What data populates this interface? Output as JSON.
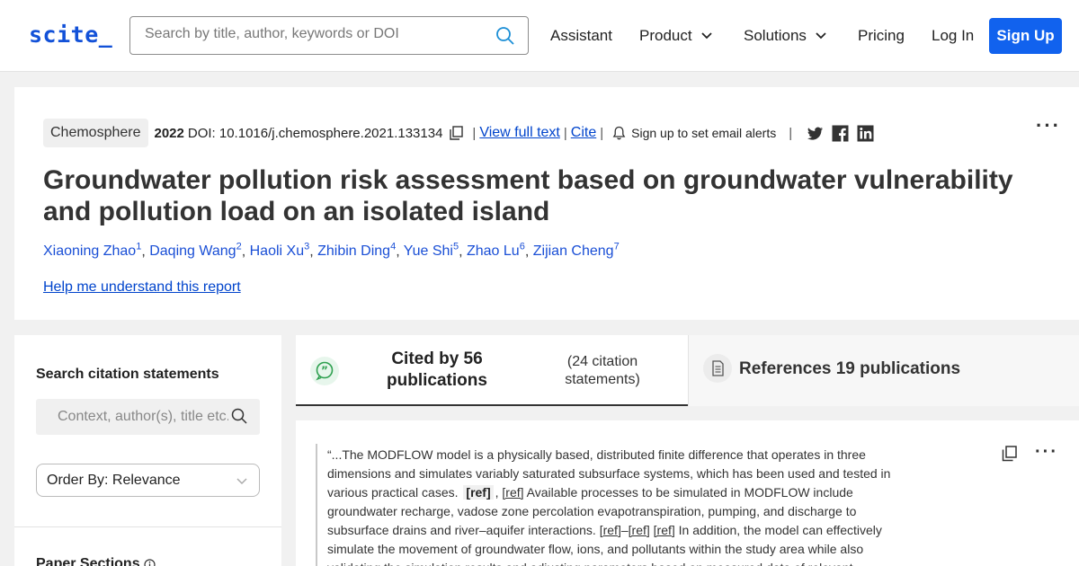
{
  "header": {
    "logo": "scite_",
    "search_placeholder": "Search by title, author, keywords or DOI",
    "nav": [
      {
        "label": "Assistant"
      },
      {
        "label": "Product"
      },
      {
        "label": "Solutions"
      },
      {
        "label": "Pricing"
      },
      {
        "label": "Log In"
      }
    ],
    "signup_label": "Sign Up"
  },
  "paper": {
    "journal": "Chemosphere",
    "year": "2022",
    "doi": "DOI: 10.1016/j.chemosphere.2021.133134",
    "sep": "|",
    "view_full_text": "View full text",
    "cite": "Cite",
    "alerts": "Sign up to set email alerts",
    "more": "···",
    "title": "Groundwater pollution risk assessment based on groundwater vulnerability and pollution load on an isolated island",
    "authors": [
      {
        "name": "Xiaoning Zhao",
        "sup": "1"
      },
      {
        "name": "Daqing Wang",
        "sup": "2"
      },
      {
        "name": "Haoli Xu",
        "sup": "3"
      },
      {
        "name": "Zhibin Ding",
        "sup": "4"
      },
      {
        "name": "Yue Shi",
        "sup": "5"
      },
      {
        "name": "Zhao Lu",
        "sup": "6"
      },
      {
        "name": "Zijian Cheng",
        "sup": "7"
      }
    ],
    "comma": ",",
    "help_link": "Help me understand this report"
  },
  "left_panel": {
    "search_heading": "Search citation statements",
    "context_placeholder": "Context, author(s), title etc.",
    "order_by": "Order By: Relevance",
    "paper_sections": "Paper Sections"
  },
  "tabs": {
    "cited_by": "Cited by 56 publications",
    "cited_statements": "(24 citation statements)",
    "references": "References 19 publications"
  },
  "citation": {
    "t1": "“...The MODFLOW model is a physically based, distributed finite difference that operates in three dimensions and simulates variably saturated subsurface systems, which has been used and tested in various practical cases.",
    "ref": "[ref]",
    "sep_comma": ",",
    "t2": "Available processes to be simulated in MODFLOW include groundwater recharge, vadose zone percolation evapotranspiration, pumping, and discharge to subsurface drains and river–aquifer interactions.",
    "dash": "–",
    "t3": "In addition, the model can effectively simulate the movement of groundwater flow, ions, and pollutants within the study area while also validating the simulation results and adjusting parameters based on measured data of relevant"
  },
  "icons": {
    "search": "search-icon",
    "copy": "copy-icon",
    "bell": "bell-icon",
    "twitter": "twitter-icon",
    "facebook": "facebook-icon",
    "linkedin": "linkedin-icon",
    "quote": "quote-icon",
    "document": "document-icon",
    "info": "info-icon"
  },
  "colors": {
    "brand": "#1251d8",
    "signup": "#1162ee",
    "link": "#0044cc",
    "author": "#1a4fd6"
  }
}
